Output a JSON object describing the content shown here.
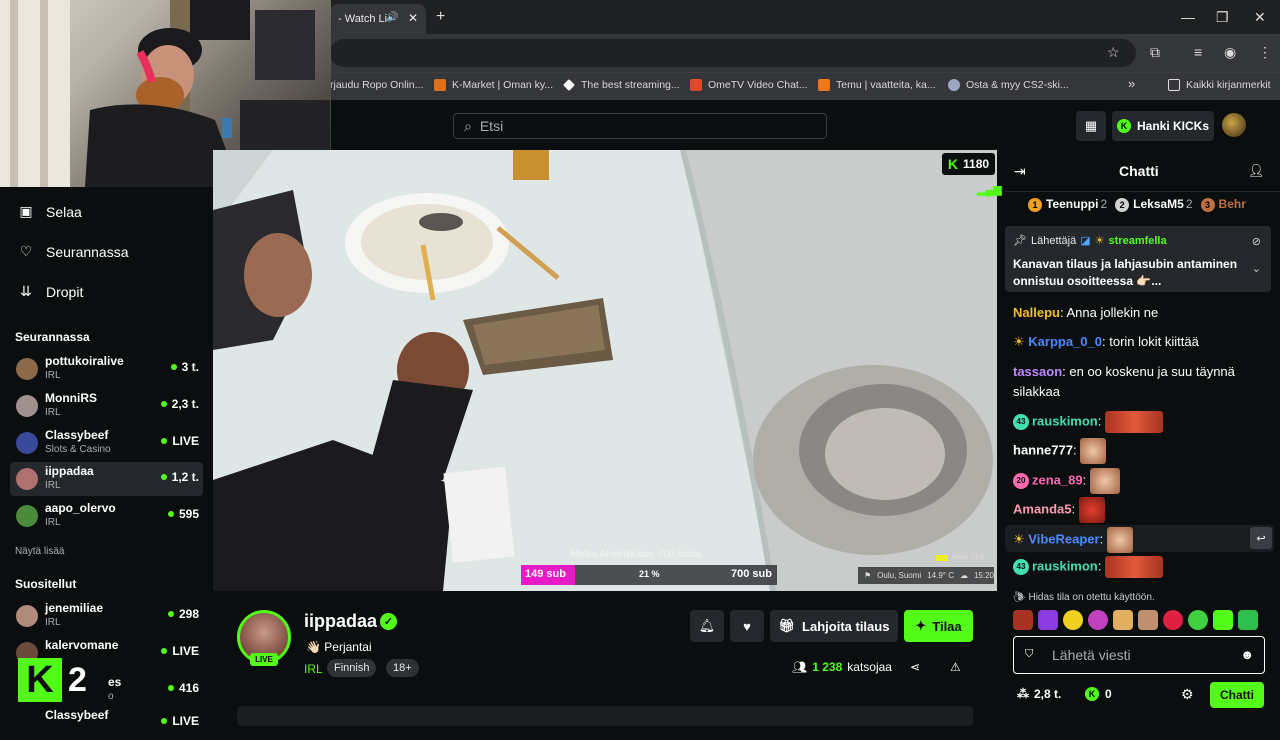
{
  "browser": {
    "tab_title": "- Watch Li",
    "bookmarks": [
      {
        "label": "rjaudu Ropo Onlin...",
        "color": "#6a6a6a"
      },
      {
        "label": "K-Market | Oman ky...",
        "color": "#e0701c"
      },
      {
        "label": "The best streaming...",
        "color": "#ffffff"
      },
      {
        "label": "OmeTV Video Chat...",
        "color": "#e04a2a"
      },
      {
        "label": "Temu | vaatteita, ka...",
        "color": "#f07a1a"
      },
      {
        "label": "Osta & myy CS2-ski...",
        "color": "#9aa8c0"
      }
    ],
    "all_bookmarks": "Kaikki kirjanmerkit",
    "more_bookmarks": "»"
  },
  "header": {
    "search_placeholder": "Etsi",
    "get_kicks": "Hanki KICKs"
  },
  "sidebar": {
    "nav": [
      {
        "label": "Selaa",
        "icon": "browse-icon"
      },
      {
        "label": "Seurannassa",
        "icon": "heart-icon"
      },
      {
        "label": "Dropit",
        "icon": "drops-icon"
      }
    ],
    "following_title": "Seurannassa",
    "following": [
      {
        "name": "pottukoiralive",
        "category": "IRL",
        "status": "3 t.",
        "color": "#8a6a4a"
      },
      {
        "name": "MonniRS",
        "category": "IRL",
        "status": "2,3 t.",
        "color": "#a09090"
      },
      {
        "name": "Classybeef",
        "category": "Slots & Casino",
        "status": "LIVE",
        "color": "#3a4a9a"
      },
      {
        "name": "iippadaa",
        "category": "IRL",
        "status": "1,2 t.",
        "color": "#b07070"
      },
      {
        "name": "aapo_olervo",
        "category": "IRL",
        "status": "595",
        "color": "#4a8a3a"
      }
    ],
    "show_more": "Näytä lisää",
    "recommended_title": "Suositellut",
    "recommended": [
      {
        "name": "jenemiliae",
        "category": "IRL",
        "status": "298",
        "color": "#b08a7a"
      },
      {
        "name": "kalervomane",
        "category": "",
        "status": "LIVE",
        "color": "#6a4a3a"
      },
      {
        "name": "es",
        "category": "o",
        "status": "416",
        "color": "#5a5a5a"
      },
      {
        "name": "Classybeef",
        "category": "",
        "status": "LIVE",
        "color": "#3a4a9a"
      }
    ],
    "k2_number": "2"
  },
  "video": {
    "viewer_badge": "1180",
    "goal_title": "Matka Amerikkaan, 700 subia",
    "goal_current": "149 sub",
    "goal_percent": "21 %",
    "goal_target": "700 sub",
    "goal_progress": 0.21,
    "weather_location": "Oulu, Suomi",
    "weather_temp": "14.9° C",
    "weather_time": "15:20",
    "battery": "Akku: 21%"
  },
  "channel": {
    "name": "iippadaa",
    "stream_title": "Perjantai",
    "category": "IRL",
    "tags": [
      "Finnish",
      "18+"
    ],
    "live_label": "LIVE",
    "viewers": "1 238",
    "viewers_label": "katsojaa",
    "gift_label": "Lahjoita tilaus",
    "subscribe_label": "Tilaa"
  },
  "chat": {
    "title": "Chatti",
    "leaderboard": [
      {
        "rank": "1",
        "name": "Teenuppi",
        "count": "2",
        "color": "#f0a020"
      },
      {
        "rank": "2",
        "name": "LeksaM5",
        "count": "2",
        "color": "#d0d0d0"
      },
      {
        "rank": "3",
        "name": "Behr",
        "count": "",
        "color": "#c07040"
      }
    ],
    "pinned": {
      "label": "Lähettäjä",
      "user": "streamfella",
      "text": "Kanavan tilaus ja lahjasubin antaminen onnistuu osoitteessa 👉🏻..."
    },
    "messages": [
      {
        "user": "Nallepu",
        "color": "#f0c020",
        "text": "Anna jollekin ne"
      },
      {
        "user": "Karppa_0_0",
        "color": "#4a8aff",
        "text": "torin lokit kiittää"
      },
      {
        "user": "tassaon",
        "color": "#c08aff",
        "text": "en oo koskenu ja suu täynnä silakkaa"
      },
      {
        "user": "rauskimon",
        "color": "#40e0b0",
        "badge": "43",
        "text": ""
      },
      {
        "user": "hanne777",
        "color": "#ffffff",
        "text": ""
      },
      {
        "user": "zena_89",
        "color": "#ff6ab0",
        "badge": "20",
        "text": ""
      },
      {
        "user": "Amanda5",
        "color": "#ff9ab0",
        "text": ""
      },
      {
        "user": "VibeReaper",
        "color": "#4a8aff",
        "text": ""
      },
      {
        "user": "rauskimon",
        "color": "#40e0b0",
        "badge": "43",
        "text": ""
      }
    ],
    "slow_mode": "Hidas tila on otettu käyttöön.",
    "input_placeholder": "Lähetä viesti",
    "points": "2,8 t.",
    "kicks": "0",
    "send_label": "Chatti"
  },
  "colors": {
    "accent": "#53fc18",
    "background": "#0b0e0f",
    "panel": "#24272c"
  }
}
